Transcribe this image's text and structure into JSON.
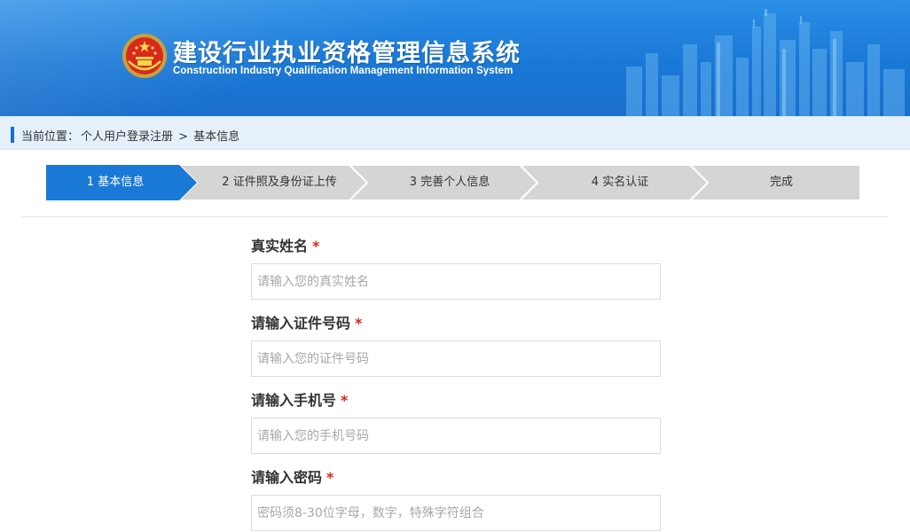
{
  "header": {
    "title_cn": "建设行业执业资格管理信息系统",
    "title_en": "Construction Industry Qualification Management Information System"
  },
  "breadcrumb": {
    "prefix": "当前位置：",
    "path": "个人用户登录注册",
    "separator": ">",
    "current": "基本信息"
  },
  "steps": [
    {
      "label": "1 基本信息",
      "active": true
    },
    {
      "label": "2 证件照及身份证上传",
      "active": false
    },
    {
      "label": "3 完善个人信息",
      "active": false
    },
    {
      "label": "4 实名认证",
      "active": false
    },
    {
      "label": "完成",
      "active": false
    }
  ],
  "form": {
    "required_mark": "*",
    "fields": [
      {
        "label": "真实姓名",
        "placeholder": "请输入您的真实姓名",
        "value": ""
      },
      {
        "label": "请输入证件号码",
        "placeholder": "请输入您的证件号码",
        "value": ""
      },
      {
        "label": "请输入手机号",
        "placeholder": "请输入您的手机号码",
        "value": ""
      },
      {
        "label": "请输入密码",
        "placeholder": "密码须8-30位字母，数字，特殊字符组合",
        "value": ""
      }
    ]
  },
  "colors": {
    "brand_blue": "#1a78d6",
    "active_step": "#1a78d6",
    "inactive_step": "#d5d5d5",
    "required": "#d9251d"
  },
  "icons": {
    "emblem": "national-emblem-icon",
    "skyline": "city-skyline-illustration"
  }
}
